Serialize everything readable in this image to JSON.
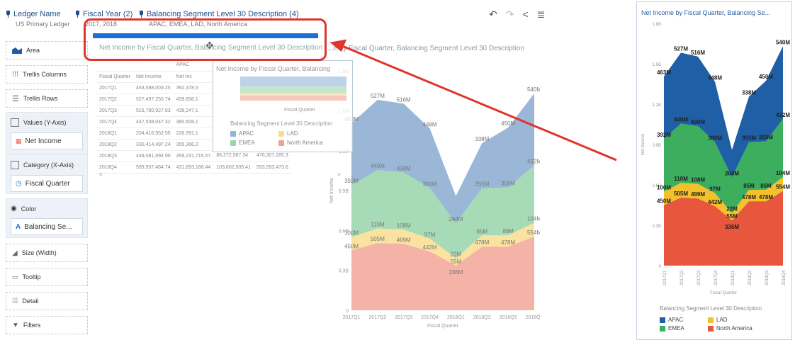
{
  "filters": [
    {
      "name": "Ledger Name",
      "value": "US Primary Ledger"
    },
    {
      "name": "Fiscal Year (2)",
      "value": "2017, 2018"
    },
    {
      "name": "Balancing Segment Level 30 Description (4)",
      "value": "APAC, EMEA, LAD, North America"
    }
  ],
  "toolbar_icons": [
    "undo-icon",
    "redo-icon",
    "share-icon",
    "menu-icon"
  ],
  "grammar": {
    "area": "Area",
    "trellis_columns": "Trellis Columns",
    "trellis_rows": "Trellis Rows",
    "values_label": "Values (Y-Axis)",
    "values_item": "Net Income",
    "category_label": "Category (X-Axis)",
    "category_item": "Fiscal Quarter",
    "color_label": "Color",
    "color_item": "Balancing Se...",
    "size": "Size (Width)",
    "tooltip": "Tooltip",
    "detail": "Detail",
    "filters": "Filters"
  },
  "table": {
    "title": "Net Income by Fiscal Quarter, Balancing Segment Level 30 Description",
    "group_header": "APAC",
    "headers": [
      "Fiscal Quarter",
      "Net Income",
      "Net Inc"
    ],
    "rows": [
      [
        "2017Q1",
        "463,588,003.25",
        "392,378,5"
      ],
      [
        "2017Q2",
        "527,497,250.74",
        "439,658,1"
      ],
      [
        "2017Q3",
        "515,780,927.93",
        "438,247,1"
      ],
      [
        "2017Q4",
        "447,538,047.32",
        "380,608,1"
      ],
      [
        "2018Q1",
        "204,416,552.55",
        "226,991,1"
      ],
      [
        "2018Q2",
        "330,414,497.24",
        "355,366,2"
      ],
      [
        "2018Q3",
        "449,081,094.90",
        "359,231,715.57",
        "86,272,587.34",
        "470,307,285.3"
      ],
      [
        "2018Q4",
        "539,937,484.74",
        "431,893,166.44",
        "103,602,905.41",
        "553,553,473.6"
      ]
    ]
  },
  "overlay": {
    "title": "Net Income by Fiscal Quarter, Balancing",
    "xlabel": "Fiscal Quarter",
    "legend_title": "Balancing Segment Level 30 Description",
    "legend": [
      "APAC",
      "LAD",
      "EMEA",
      "North America"
    ]
  },
  "main_chart_title": "...e by Fiscal Quarter, Balancing Segment Level 30 Description",
  "main_chart_labels": {
    "apac": [
      "463M",
      "527M",
      "516M",
      "448M",
      "",
      "338M",
      "450M",
      "540M"
    ],
    "emea": [
      "392M",
      "440M",
      "430M",
      "380M",
      "264M",
      "355M",
      "359M",
      "432M"
    ],
    "lad": [
      "100M",
      "110M",
      "108M",
      "97M",
      "22M",
      "85M",
      "86M",
      "104M"
    ],
    "na": [
      "450M",
      "505M",
      "499M",
      "442M",
      "55M",
      "478M",
      "478M",
      "554M"
    ],
    "na2": [
      "",
      "",
      "",
      "",
      "336M",
      "",
      "",
      ""
    ]
  },
  "right_panel": {
    "title": "Net Income by Fiscal Quarter, Balancing Se...",
    "ylabel": "Net Income",
    "xlabel": "Fiscal Quarter",
    "legend_title": "Balancing Segment Level 30 Description",
    "legend": [
      {
        "name": "APAC",
        "color": "#1f5fa6"
      },
      {
        "name": "LAD",
        "color": "#f3c12c"
      },
      {
        "name": "EMEA",
        "color": "#3cae5d"
      },
      {
        "name": "North America",
        "color": "#e8563d"
      }
    ]
  },
  "chart_data": {
    "type": "area",
    "title": "Net Income by Fiscal Quarter, Balancing Segment Level 30 Description",
    "xlabel": "Fiscal Quarter",
    "ylabel": "Net Income",
    "categories": [
      "2017Q1",
      "2017Q2",
      "2017Q3",
      "2017Q4",
      "2018Q1",
      "2018Q2",
      "2018Q3",
      "2018Q4"
    ],
    "yticks": [
      "0",
      "0.3B",
      "0.6B",
      "0.9B",
      "1.2B",
      "1.5B",
      "1.8B"
    ],
    "ylim": [
      0,
      1800
    ],
    "units": "M",
    "stacked": true,
    "series": [
      {
        "name": "North America",
        "values": [
          450,
          505,
          499,
          442,
          336,
          478,
          478,
          554
        ]
      },
      {
        "name": "LAD",
        "values": [
          100,
          110,
          108,
          97,
          55,
          85,
          86,
          104
        ]
      },
      {
        "name": "EMEA",
        "values": [
          392,
          440,
          430,
          380,
          264,
          355,
          359,
          432
        ]
      },
      {
        "name": "APAC",
        "values": [
          463,
          527,
          516,
          448,
          204,
          338,
          450,
          540
        ]
      }
    ],
    "data_labels": {
      "APAC": [
        "463M",
        "527M",
        "516M",
        "448M",
        "",
        "338M",
        "450M",
        "540M"
      ],
      "EMEA": [
        "392M",
        "440M",
        "430M",
        "380M",
        "264M",
        "355M",
        "359M",
        "432M"
      ],
      "LAD": [
        "100M",
        "110M",
        "108M",
        "97M",
        "22M",
        "85M",
        "86M",
        "104M"
      ],
      "North America": [
        "450M",
        "505M",
        "499M",
        "442M",
        "55M",
        "478M",
        "478M",
        "554M"
      ],
      "North America (2)": [
        "",
        "",
        "",
        "",
        "336M",
        "",
        "",
        ""
      ]
    },
    "colors": {
      "APAC": "#1f5fa6",
      "EMEA": "#3cae5d",
      "LAD": "#f3c12c",
      "North America": "#e8563d"
    },
    "legend_position": "bottom"
  }
}
